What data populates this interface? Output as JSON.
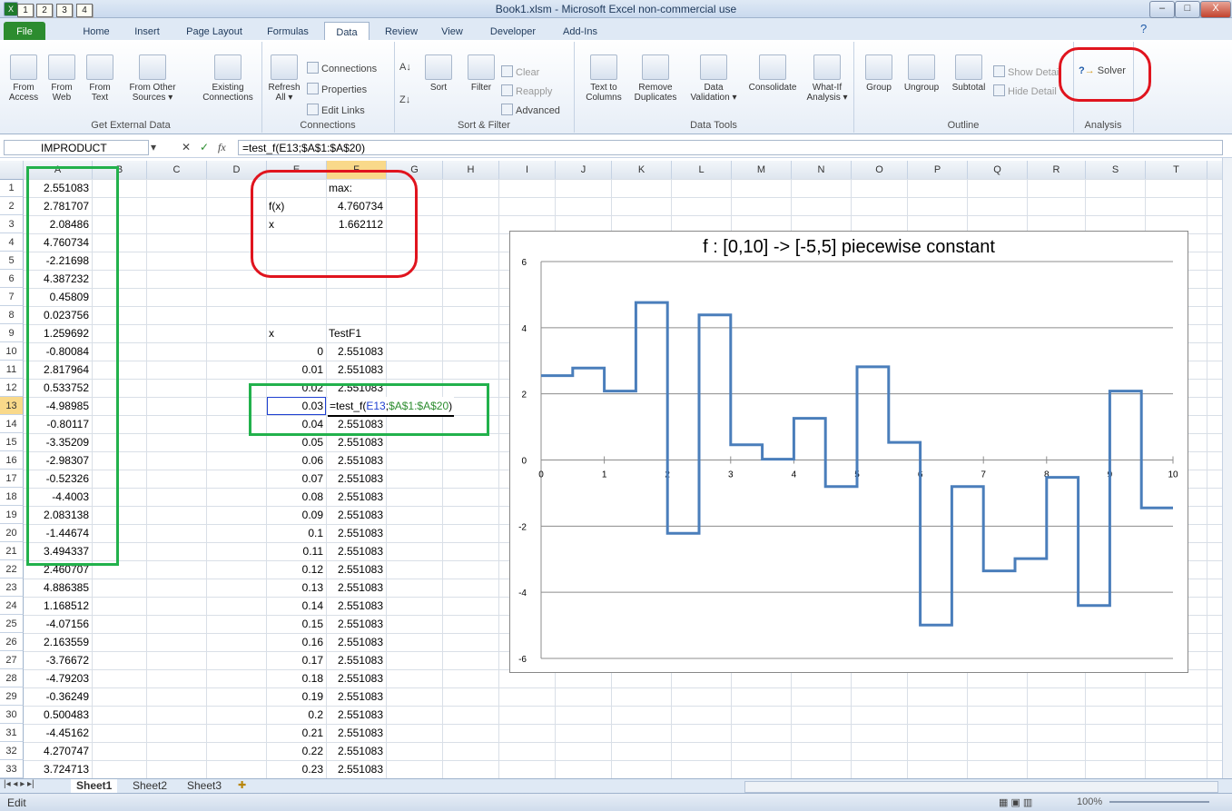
{
  "window": {
    "title": "Book1.xlsm  -  Microsoft Excel non-commercial use",
    "qat_keytips": [
      "1",
      "2",
      "3",
      "4"
    ],
    "buttons": [
      "–",
      "□",
      "X"
    ]
  },
  "tabs": [
    {
      "label": "File",
      "key": "F"
    },
    {
      "label": "Home",
      "key": "H"
    },
    {
      "label": "Insert",
      "key": "N"
    },
    {
      "label": "Page Layout",
      "key": "P"
    },
    {
      "label": "Formulas",
      "key": "M"
    },
    {
      "label": "Data",
      "key": "A"
    },
    {
      "label": "Review",
      "key": "R"
    },
    {
      "label": "View",
      "key": "W"
    },
    {
      "label": "Developer",
      "key": "L"
    },
    {
      "label": "Add-Ins",
      "key": "X"
    }
  ],
  "ribbon": {
    "external": {
      "label": "Get External Data",
      "b1": "From",
      "b1b": "Access",
      "b2": "From",
      "b2b": "Web",
      "b3": "From",
      "b3b": "Text",
      "b4": "From Other",
      "b4b": "Sources ▾",
      "b5": "Existing",
      "b5b": "Connections"
    },
    "connections": {
      "label": "Connections",
      "refresh": "Refresh",
      "refresh_b": "All ▾",
      "s1": "Connections",
      "s2": "Properties",
      "s3": "Edit Links"
    },
    "sortfilter": {
      "label": "Sort & Filter",
      "sort": "Sort",
      "filter": "Filter",
      "s1": "Clear",
      "s2": "Reapply",
      "s3": "Advanced"
    },
    "datatools": {
      "label": "Data Tools",
      "b1": "Text to",
      "b1b": "Columns",
      "b2": "Remove",
      "b2b": "Duplicates",
      "b3": "Data",
      "b3b": "Validation ▾",
      "b4": "Consolidate",
      "b5": "What-If",
      "b5b": "Analysis ▾"
    },
    "outline": {
      "label": "Outline",
      "b1": "Group",
      "b2": "Ungroup",
      "b3": "Subtotal",
      "s1": "Show Detail",
      "s2": "Hide Detail"
    },
    "analysis": {
      "label": "Analysis",
      "solver": "Solver"
    }
  },
  "formula_bar": {
    "name_box": "IMPRODUCT",
    "formula": "=test_f(E13;$A$1:$A$20)",
    "icons": [
      "▾",
      "✕",
      "✓",
      "fx"
    ]
  },
  "columns": [
    "A",
    "B",
    "C",
    "D",
    "E",
    "F",
    "G",
    "H",
    "I",
    "J",
    "K",
    "L",
    "M",
    "N",
    "O",
    "P",
    "Q",
    "R",
    "S",
    "T"
  ],
  "rows": [
    "1",
    "2",
    "3",
    "4",
    "5",
    "6",
    "7",
    "8",
    "9",
    "10",
    "11",
    "12",
    "13",
    "14",
    "15",
    "16",
    "17",
    "18",
    "19",
    "20",
    "21",
    "22",
    "23",
    "24",
    "25",
    "26",
    "27",
    "28",
    "29",
    "30",
    "31",
    "32",
    "33"
  ],
  "col_a": [
    "2.551083",
    "2.781707",
    "2.08486",
    "4.760734",
    "-2.21698",
    "4.387232",
    "0.45809",
    "0.023756",
    "1.259692",
    "-0.80084",
    "2.817964",
    "0.533752",
    "-4.98985",
    "-0.80117",
    "-3.35209",
    "-2.98307",
    "-0.52326",
    "-4.4003",
    "2.083138",
    "-1.44674",
    "3.494337",
    "2.460707",
    "4.886385",
    "1.168512",
    "-4.07156",
    "2.163559",
    "-3.76672",
    "-4.79203",
    "-0.36249",
    "0.500483",
    "-4.45162",
    "4.270747",
    "3.724713"
  ],
  "summary": {
    "max_label": "max:",
    "fx_label": "f(x)",
    "fx_value": "4.760734",
    "x_label": "x",
    "x_value": "1.662112"
  },
  "table": {
    "header_x": "x",
    "header_f": "TestF1",
    "x": [
      "0",
      "0.01",
      "0.02",
      "0.03",
      "0.04",
      "0.05",
      "0.06",
      "0.07",
      "0.08",
      "0.09",
      "0.1",
      "0.11",
      "0.12",
      "0.13",
      "0.14",
      "0.15",
      "0.16",
      "0.17",
      "0.18",
      "0.19",
      "0.2",
      "0.21",
      "0.22",
      "0.23"
    ],
    "f": [
      "2.551083",
      "2.551083",
      "2.551083",
      "",
      "2.551083",
      "2.551083",
      "2.551083",
      "2.551083",
      "2.551083",
      "2.551083",
      "2.551083",
      "2.551083",
      "2.551083",
      "2.551083",
      "2.551083",
      "2.551083",
      "2.551083",
      "2.551083",
      "2.551083",
      "2.551083",
      "2.551083",
      "2.551083",
      "2.551083",
      "2.551083"
    ],
    "edit_formula_a": "=test_f(",
    "edit_formula_b": "E13",
    "edit_formula_c": ";",
    "edit_formula_d": "$A$1:$A$20",
    "edit_formula_e": ")"
  },
  "chart_data": {
    "type": "line",
    "title": "f : [0,10] -> [-5,5]   piecewise constant",
    "xlabel": "",
    "ylabel": "",
    "xlim": [
      0,
      10
    ],
    "ylim": [
      -6,
      6
    ],
    "xticks": [
      "0",
      "1",
      "2",
      "3",
      "4",
      "5",
      "6",
      "7",
      "8",
      "9",
      "10"
    ],
    "yticks": [
      "6",
      "4",
      "2",
      "0",
      "-2",
      "-4",
      "-6"
    ],
    "grid": "horizontal",
    "series": [
      {
        "color": "#4a7ebb",
        "values": [
          2.551083,
          2.781707,
          2.08486,
          4.760734,
          -2.21698,
          4.387232,
          0.45809,
          0.023756,
          1.259692,
          -0.80084,
          2.817964,
          0.533752,
          -4.98985,
          -0.80117,
          -3.35209,
          -2.98307,
          -0.52326,
          -4.4003,
          2.083138,
          -1.44674
        ],
        "step": 0.5
      }
    ]
  },
  "sheet_tabs": [
    "Sheet1",
    "Sheet2",
    "Sheet3"
  ],
  "status": {
    "mode": "Edit",
    "zoom": "100%"
  },
  "colors": {
    "annotation_green": "#22b14c",
    "annotation_red": "#e0141e",
    "selected_header": "#f9d98a"
  }
}
